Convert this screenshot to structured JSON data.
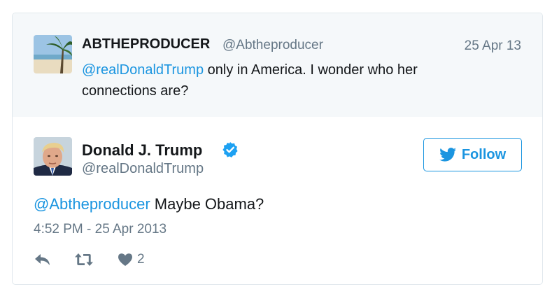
{
  "parent_tweet": {
    "display_name": "ABTHEPRODUCER",
    "handle": "@Abtheproducer",
    "date": "25 Apr 13",
    "mention": "@realDonaldTrump",
    "text": " only in America. I wonder who her connections are?",
    "avatar_icon": "beach-palm-avatar"
  },
  "main_tweet": {
    "display_name": "Donald J. Trump",
    "handle": "@realDonaldTrump",
    "verified_icon": "verified-badge-icon",
    "follow_label": "Follow",
    "mention": "@Abtheproducer",
    "text": " Maybe Obama?",
    "timestamp": "4:52 PM - 25 Apr 2013",
    "like_count": "2",
    "avatar_icon": "portrait-avatar"
  },
  "colors": {
    "link": "#1b95e0",
    "muted": "#657786",
    "text": "#14171a",
    "parent_bg": "#f5f8fa",
    "border": "#e1e8ed"
  }
}
